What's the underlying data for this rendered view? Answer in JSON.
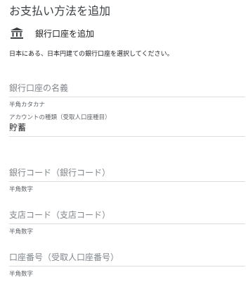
{
  "page": {
    "title": "お支払い方法を追加"
  },
  "bank": {
    "label": "銀行口座を追加",
    "icon": "bank-icon"
  },
  "description": "日本にある、日本円建ての銀行口座を選択してください。",
  "fields": {
    "account_name": {
      "placeholder": "銀行口座の名義",
      "hint": "半角カタカナ"
    },
    "account_type": {
      "label": "アカウントの種類（受取人口座種目）",
      "value": "貯蓄"
    },
    "bank_code": {
      "placeholder": "銀行コード（銀行コード）",
      "hint": "半角数字"
    },
    "branch_code": {
      "placeholder": "支店コード（支店コード）",
      "hint": "半角数字"
    },
    "account_number": {
      "placeholder": "口座番号（受取人口座番号）",
      "hint": "半角数字"
    }
  }
}
